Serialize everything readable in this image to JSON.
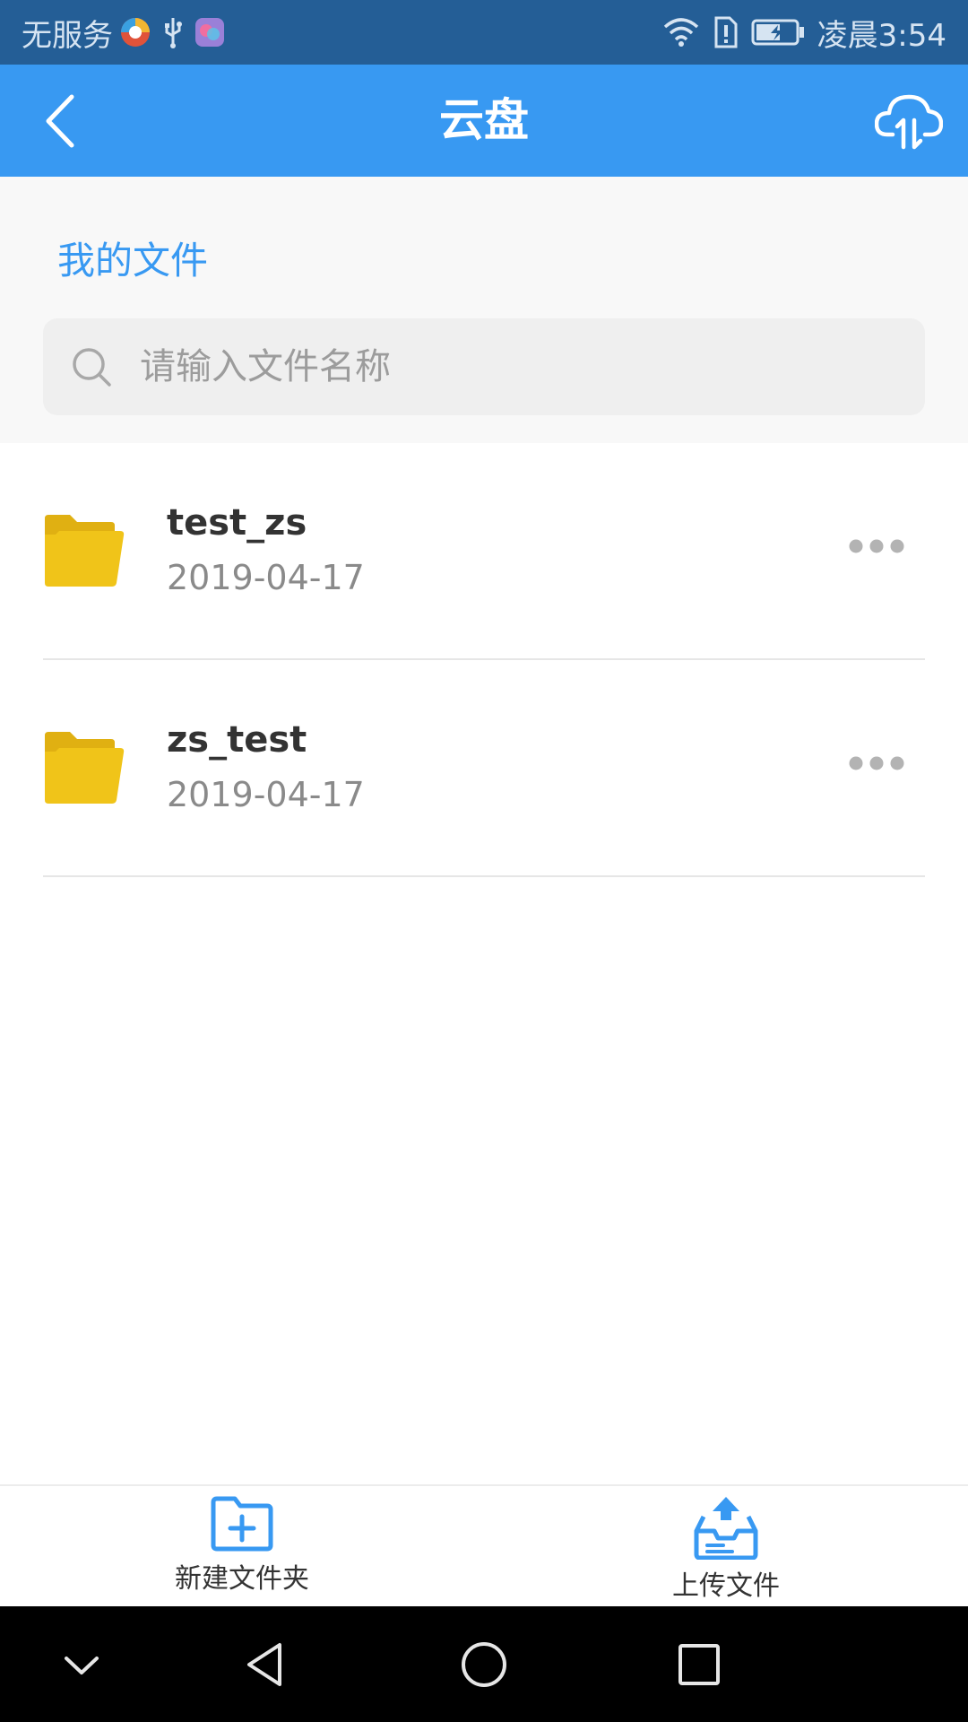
{
  "status_bar": {
    "carrier": "无服务",
    "time": "凌晨3:54"
  },
  "header": {
    "title": "云盘",
    "back_icon": "chevron-left-icon",
    "cloud_icon": "cloud-transfer-icon"
  },
  "section": {
    "title": "我的文件"
  },
  "search": {
    "placeholder": "请输入文件名称"
  },
  "files": [
    {
      "name": "test_zs",
      "date": "2019-04-17"
    },
    {
      "name": "zs_test",
      "date": "2019-04-17"
    }
  ],
  "toolbar": {
    "new_folder_label": "新建文件夹",
    "upload_label": "上传文件"
  },
  "colors": {
    "status_bar": "#245e96",
    "title_bar": "#3899f2",
    "accent": "#3899f2",
    "folder": "#f0c419"
  }
}
